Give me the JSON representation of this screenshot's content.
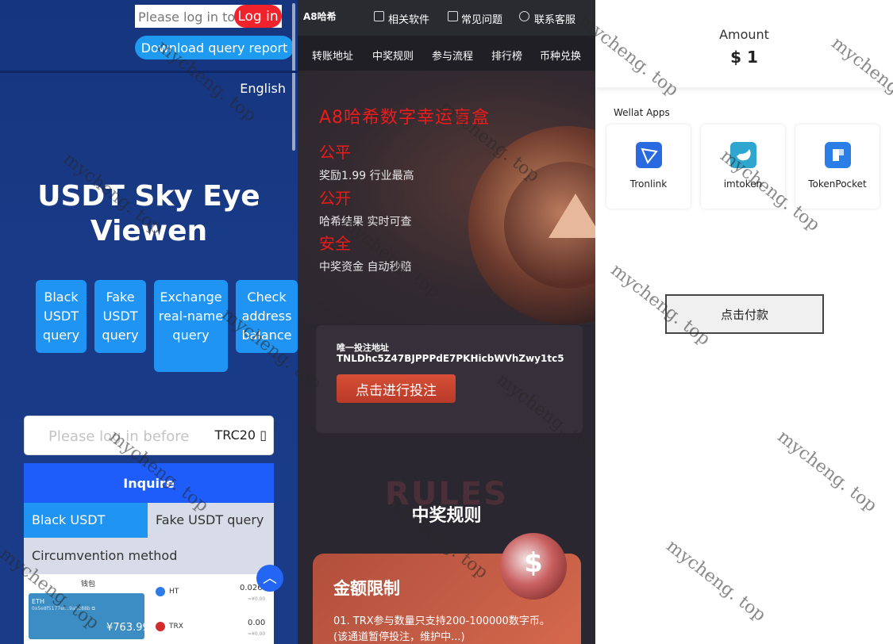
{
  "left": {
    "login_placeholder": "Please log in to",
    "login_button": "Log in",
    "download_button": "Download query report",
    "language": "English",
    "hero_title_line1": "USDT Sky Eye",
    "hero_title_line2": "Viewen",
    "query_buttons": [
      "Black USDT query",
      "Fake USDT query",
      "Exchange real-name query",
      "Check address balance"
    ],
    "address_placeholder": "Please log in before",
    "network": "TRC20 ▯",
    "inquire_button": "Inquire",
    "tabs": [
      "Black USDT query",
      "Fake USDT query"
    ],
    "circumvention": "Circumvention method",
    "wallet": {
      "title": "钱包",
      "card_chain": "ETH",
      "card_address": "0x5e8f5177ef...9a5a88b  ⧉",
      "card_amount": "¥763.99",
      "coins": [
        {
          "symbol": "HT",
          "value": "0.0260",
          "sub": "≈¥0.00"
        },
        {
          "symbol": "TRX",
          "value": "0.00",
          "sub": "≈¥0.00"
        }
      ]
    },
    "scroll_top_icon": "chevron-up-icon"
  },
  "middle": {
    "brand": "A8哈希",
    "top_nav": [
      "相关软件",
      "常见问题",
      "联系客服"
    ],
    "menu": [
      "转账地址",
      "中奖规则",
      "参与流程",
      "排行榜",
      "币种兑换"
    ],
    "hero_title": "A8哈希数字幸运盲盒",
    "features": [
      {
        "heading": "公平",
        "text": "奖励1.99 行业最高"
      },
      {
        "heading": "公开",
        "text": "哈希结果 实时可查"
      },
      {
        "heading": "安全",
        "text": "中奖资金 自动秒赔"
      }
    ],
    "bet_label": "唯一投注地址",
    "bet_address": "TNLDhc5Z47BJPPPdE7PKHicbWVhZwy1tc5",
    "bet_button": "点击进行投注",
    "rules_bg": "RULES",
    "rules_title": "中奖规则",
    "limit_title": "金额限制",
    "limit_text": "01. TRX参与数量只支持200-100000数字币。(该通道暂停投注，维护中...)"
  },
  "right": {
    "amount_label": "Amount",
    "amount_value": "$ 1",
    "apps_label": "Wellat Apps",
    "apps": [
      {
        "name": "Tronlink",
        "icon": "tronlink-icon",
        "color": "#2a6ae0"
      },
      {
        "name": "imtoken",
        "icon": "imtoken-icon",
        "color": "#2ea6cf"
      },
      {
        "name": "TokenPocket",
        "icon": "tokenpocket-icon",
        "color": "#2a7ee6"
      }
    ],
    "pay_button": "点击付款"
  },
  "watermark": "mycheng. top",
  "colors": {
    "left_bg": "#193a86",
    "login_red": "#f0222c",
    "download_blue": "#1e9af1",
    "inquire_blue": "#1e5dfa",
    "mid_bg": "#2b2730",
    "hero_red": "#ee1b1b"
  }
}
